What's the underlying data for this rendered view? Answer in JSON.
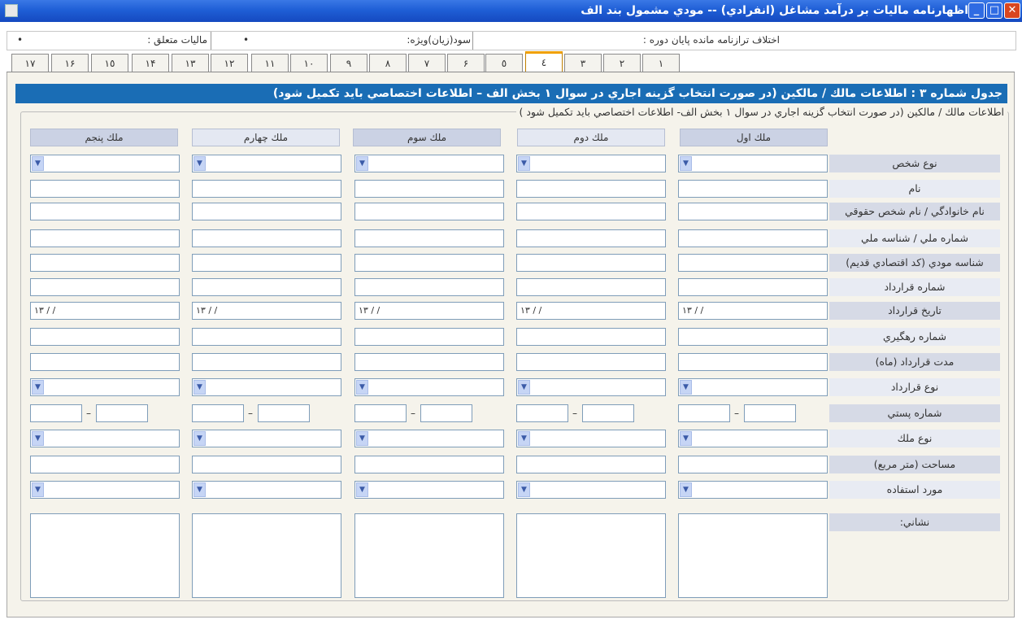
{
  "window": {
    "title": "اظهارنامه ماليات بر درآمد مشاغل (انفرادي) -- مودي مشمول بند الف",
    "close": "✕",
    "maximize": "□",
    "minimize": "_"
  },
  "info_bar": {
    "diff_label": "اختلاف ترازنامه مانده پايان دوره :",
    "profit_label": "سود(زيان)ويژه:",
    "profit_value": "•",
    "tax_label": "ماليات متعلق :",
    "tax_value": "•"
  },
  "tabs": [
    "١",
    "٢",
    "٣",
    "٤",
    "٥",
    "۶",
    "٧",
    "٨",
    "٩",
    "١٠",
    "١١",
    "١٢",
    "١٣",
    "١۴",
    "١٥",
    "١۶",
    "١٧"
  ],
  "active_tab": "٤",
  "table_header": "جدول شماره ٣ : اطلاعات مالك / مالكين (در صورت انتخاب گزينه اجاري در سوال ١ بخش الف – اطلاعات اختصاصي بايد تكميل شود)",
  "group_caption": "اطلاعات مالك / مالكين (در صورت انتخاب گزينه اجاري در سوال ١ بخش الف- اطلاعات اختصاصي بايد تكميل شود )",
  "columns": [
    "ملك اول",
    "ملك دوم",
    "ملك سوم",
    "ملك چهارم",
    "ملك پنجم"
  ],
  "rows": {
    "person_type": "نوع شخص",
    "name": "نام",
    "family": "نام خانوادگي / نام شخص حقوقي",
    "national_id": "شماره ملي / شناسه ملي",
    "taxpayer_id": "شناسه مودي (كد اقتصادي قديم)",
    "contract_no": "شماره قرارداد",
    "contract_date": "تاريخ قرارداد",
    "tracking_no": "شماره رهگيري",
    "duration": "مدت قرارداد (ماه)",
    "contract_type": "نوع قرارداد",
    "postal_code": "شماره پستي",
    "property_type": "نوع ملك",
    "area": "مساحت (متر مربع)",
    "usage": "مورد استفاده",
    "address": "نشاني:"
  },
  "date_placeholder": "١٣ / /",
  "dropdown_arrow": "▼",
  "postal_dash": "–",
  "colors": {
    "title_bar": "#1f5fd6",
    "header_blue": "#1a6db5",
    "panel_bg": "#f5f3eb",
    "active_tab": "#f0a000"
  },
  "icons": {
    "app": "app-icon",
    "dropdown": "chevron-down-icon"
  }
}
